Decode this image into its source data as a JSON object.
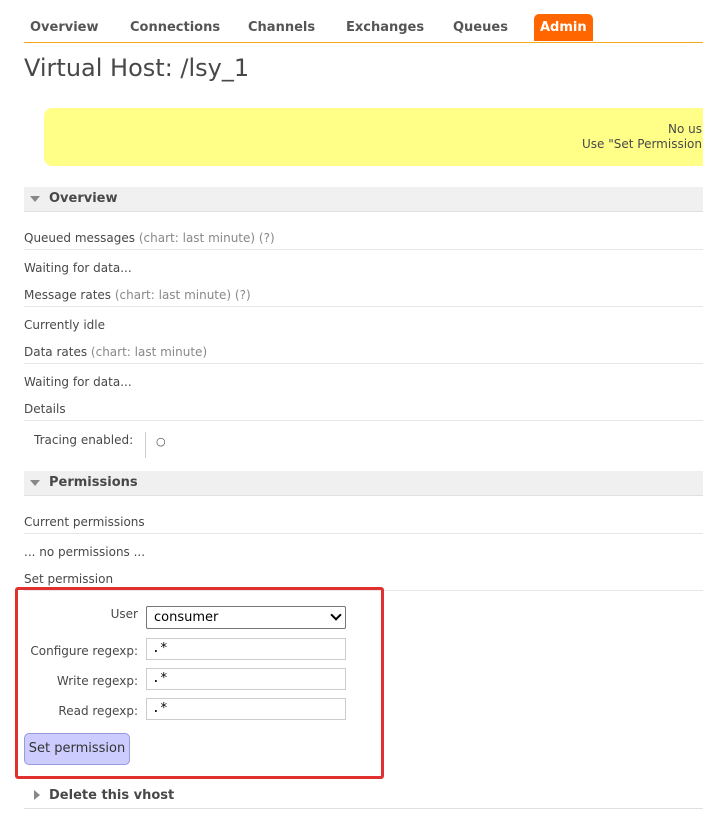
{
  "nav": {
    "items": [
      "Overview",
      "Connections",
      "Channels",
      "Exchanges",
      "Queues",
      "Admin"
    ]
  },
  "page_title": "Virtual Host: /lsy_1",
  "warning": {
    "line1": "No us",
    "line2": "Use \"Set Permission"
  },
  "overview": {
    "title": "Overview",
    "queued_label": "Queued messages",
    "queued_meta": "(chart: last minute) (?)",
    "queued_status": "Waiting for data...",
    "rates_label": "Message rates",
    "rates_meta": "(chart: last minute) (?)",
    "rates_status": "Currently idle",
    "data_label": "Data rates",
    "data_meta": "(chart: last minute)",
    "data_status": "Waiting for data...",
    "details_label": "Details",
    "tracing_label": "Tracing enabled:",
    "tracing_value": "○"
  },
  "permissions": {
    "title": "Permissions",
    "current_label": "Current permissions",
    "current_value": "... no permissions ...",
    "set_label": "Set permission",
    "user_label": "User",
    "user_value": "consumer",
    "configure_label": "Configure regexp:",
    "configure_value": ".*",
    "write_label": "Write regexp:",
    "write_value": ".*",
    "read_label": "Read regexp:",
    "read_value": ".*",
    "button": "Set permission"
  },
  "delete_section": {
    "title": "Delete this vhost"
  },
  "colors": {
    "accent": "#ff6600",
    "highlight": "#e03030",
    "warning_bg": "#ffff88",
    "button_bg": "#ccccff"
  }
}
